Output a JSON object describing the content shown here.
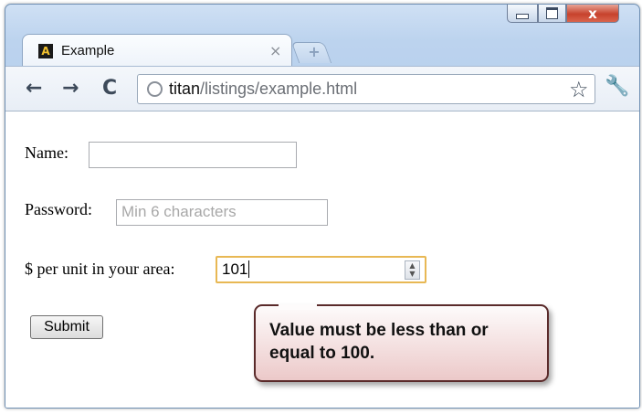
{
  "window": {
    "controls": {
      "minimize_icon": "minimize-icon",
      "maximize_icon": "maximize-icon",
      "close_glyph": "x"
    }
  },
  "tab": {
    "favicon_letter": "A",
    "title": "Example",
    "close_glyph": "×",
    "new_tab_glyph": "+"
  },
  "toolbar": {
    "back_glyph": "←",
    "forward_glyph": "→",
    "reload_glyph": "C",
    "url_host": "titan",
    "url_path": "/listings/example.html",
    "star_glyph": "☆",
    "wrench_glyph": "🔧"
  },
  "form": {
    "name_label": "Name:",
    "name_value": "",
    "password_label": "Password:",
    "password_placeholder": "Min 6 characters",
    "price_label": "$ per unit in your area:",
    "price_value": "101",
    "submit_label": "Submit"
  },
  "validation": {
    "message": "Value must be less than or equal to 100."
  }
}
